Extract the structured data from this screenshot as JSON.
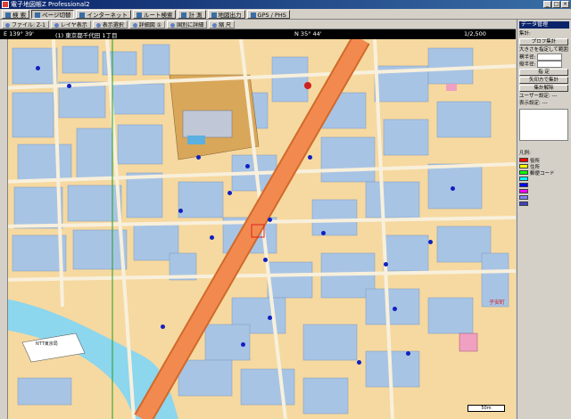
{
  "window": {
    "title": "電子地図帳Z Professional2"
  },
  "toolbar": {
    "items": [
      {
        "label": "検 索",
        "active": false
      },
      {
        "label": "ページ切替",
        "active": true
      },
      {
        "label": "インターネット",
        "active": false
      },
      {
        "label": "ルート検索",
        "active": false
      },
      {
        "label": "計 測",
        "active": false
      },
      {
        "label": "地図出力",
        "active": false
      },
      {
        "label": "GPS / PHS",
        "active": false
      }
    ]
  },
  "subtoolbar": {
    "items": [
      {
        "label": "ファイル: Z-1"
      },
      {
        "label": "レイヤ表示"
      },
      {
        "label": "表示選択"
      },
      {
        "label": "詳細図 ①"
      },
      {
        "label": "国別に詳細"
      },
      {
        "label": "縮 尺"
      }
    ]
  },
  "coordinates": {
    "longitude": "E 139° 39'",
    "latitude": "N 35° 44'",
    "zoom": "1/2,500",
    "address": "(1) 東京都千代田 1丁目"
  },
  "panel": {
    "title": "データ管理",
    "row1": "集計:",
    "btn1": "プロフ集計",
    "row2": "大きさを指定して範囲",
    "label_w": "横半径:",
    "label_h": "縦半径:",
    "btn2": "指 定",
    "btn3": "矢印方で集計",
    "btn4": "集計解除",
    "row3": "ユーザー設定: ---",
    "row4": "表示設定: ---",
    "legend_title": "凡例:",
    "legend": [
      {
        "color": "#ff0000",
        "label": "役所"
      },
      {
        "color": "#ffff00",
        "label": "住所"
      },
      {
        "color": "#00ff00",
        "label": "郵便コード"
      },
      {
        "color": "#00ffff",
        "label": ""
      },
      {
        "color": "#0000ff",
        "label": ""
      },
      {
        "color": "#ff00ff",
        "label": ""
      },
      {
        "color": "#8080ff",
        "label": ""
      },
      {
        "color": "#4040c0",
        "label": ""
      }
    ]
  },
  "map_labels": [
    {
      "text": "NTT東京局"
    },
    {
      "text": "子安町"
    },
    {
      "text": "50m"
    }
  ]
}
